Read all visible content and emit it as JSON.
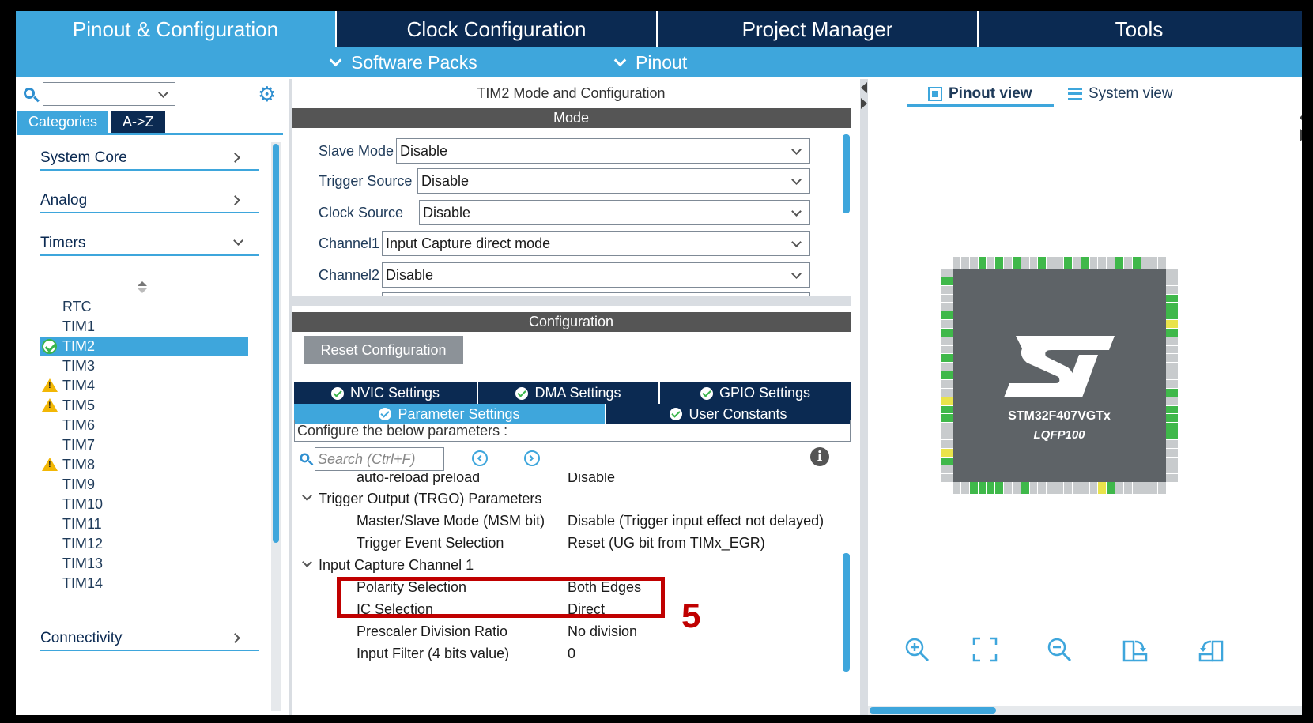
{
  "topnav": {
    "tabs": [
      {
        "label": "Pinout & Configuration"
      },
      {
        "label": "Clock Configuration"
      },
      {
        "label": "Project Manager"
      },
      {
        "label": "Tools"
      }
    ]
  },
  "subnav": {
    "software_packs": "Software Packs",
    "pinout": "Pinout"
  },
  "sidebar": {
    "search_value": "",
    "tab_categories": "Categories",
    "tab_az": "A->Z",
    "categories": {
      "system_core": "System Core",
      "analog": "Analog",
      "timers": "Timers",
      "connectivity": "Connectivity"
    },
    "timers": [
      {
        "label": "RTC",
        "status": "none"
      },
      {
        "label": "TIM1",
        "status": "none"
      },
      {
        "label": "TIM2",
        "status": "configured",
        "selected": true
      },
      {
        "label": "TIM3",
        "status": "none"
      },
      {
        "label": "TIM4",
        "status": "warning"
      },
      {
        "label": "TIM5",
        "status": "warning"
      },
      {
        "label": "TIM6",
        "status": "none"
      },
      {
        "label": "TIM7",
        "status": "none"
      },
      {
        "label": "TIM8",
        "status": "warning"
      },
      {
        "label": "TIM9",
        "status": "none"
      },
      {
        "label": "TIM10",
        "status": "none"
      },
      {
        "label": "TIM11",
        "status": "none"
      },
      {
        "label": "TIM12",
        "status": "none"
      },
      {
        "label": "TIM13",
        "status": "none"
      },
      {
        "label": "TIM14",
        "status": "none"
      }
    ]
  },
  "mode": {
    "title": "TIM2 Mode and Configuration",
    "header": "Mode",
    "fields": {
      "slave_mode": {
        "label": "Slave Mode",
        "value": "Disable"
      },
      "trigger_source": {
        "label": "Trigger Source",
        "value": "Disable"
      },
      "clock_source": {
        "label": "Clock Source",
        "value": "Disable"
      },
      "channel1": {
        "label": "Channel1",
        "value": "Input Capture direct mode"
      },
      "channel2": {
        "label": "Channel2",
        "value": "Disable"
      }
    }
  },
  "configuration": {
    "header": "Configuration",
    "reset_button": "Reset Configuration",
    "tabs": {
      "nvic": "NVIC Settings",
      "dma": "DMA Settings",
      "gpio": "GPIO Settings",
      "parameter": "Parameter Settings",
      "user_constants": "User Constants"
    },
    "configure_text": "Configure the below parameters :",
    "search_placeholder": "Search (Ctrl+F)",
    "params": {
      "autoreload": {
        "name": "auto-reload preload",
        "value": "Disable"
      },
      "trgo_group": "Trigger Output (TRGO) Parameters",
      "msm": {
        "name": "Master/Slave Mode (MSM bit)",
        "value": "Disable (Trigger input effect not delayed)"
      },
      "trigger_event": {
        "name": "Trigger Event Selection",
        "value": "Reset (UG bit from TIMx_EGR)"
      },
      "ic_group": "Input Capture Channel 1",
      "polarity": {
        "name": "Polarity Selection",
        "value": "Both Edges"
      },
      "ic_selection": {
        "name": "IC Selection",
        "value": "Direct"
      },
      "prescaler": {
        "name": "Prescaler Division Ratio",
        "value": "No division"
      },
      "input_filter": {
        "name": "Input Filter (4 bits value)",
        "value": "0"
      }
    }
  },
  "annotation": {
    "step_number": "5",
    "color": "#c00000"
  },
  "pinout": {
    "tab_pinout_view": "Pinout view",
    "tab_system_view": "System view",
    "chip_name": "STM32F407VGTx",
    "package": "LQFP100"
  },
  "colors": {
    "dark_navy": "#0b2a52",
    "accent_blue": "#3ea6dc",
    "pin_green": "#3fb84a",
    "chip_gray": "#5e6367"
  }
}
